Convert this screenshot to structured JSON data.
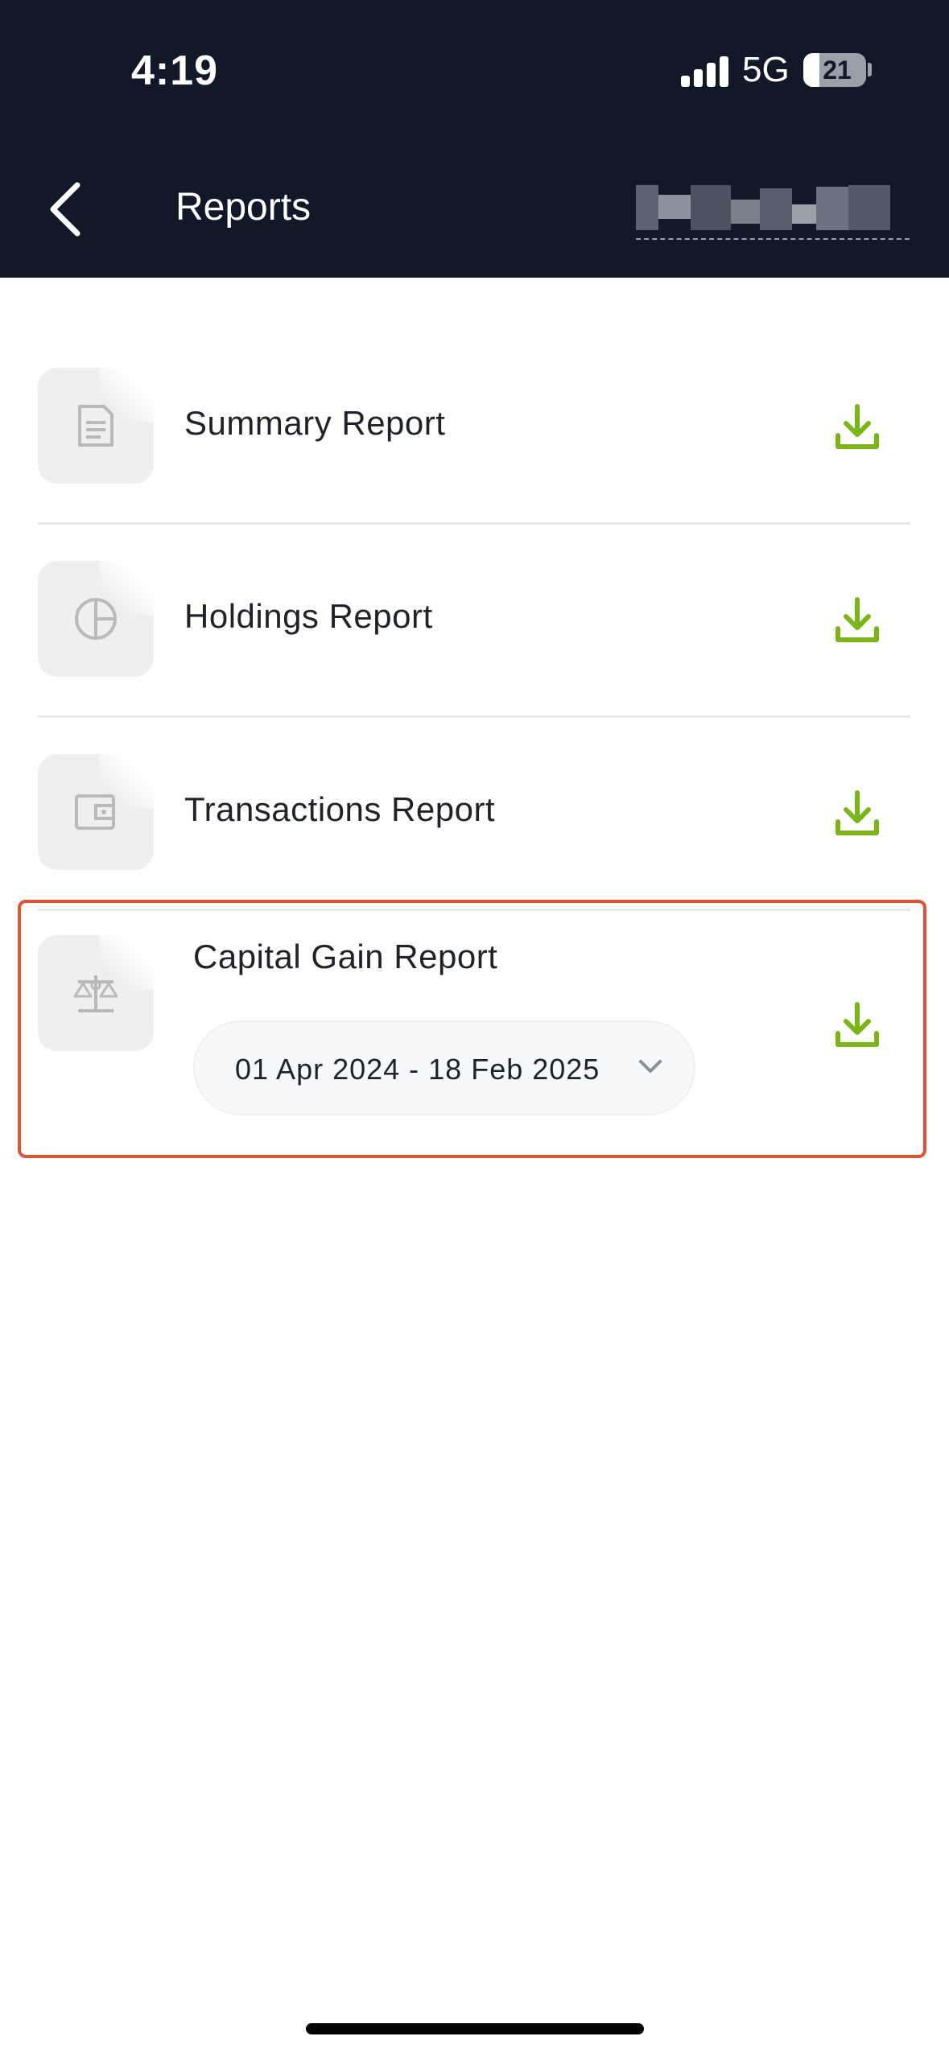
{
  "status_bar": {
    "time": "4:19",
    "network": "5G",
    "battery": "21"
  },
  "header": {
    "title": "Reports"
  },
  "reports": [
    {
      "label": "Summary Report",
      "icon": "document-icon"
    },
    {
      "label": "Holdings Report",
      "icon": "pie-chart-icon"
    },
    {
      "label": "Transactions Report",
      "icon": "wallet-icon"
    }
  ],
  "capital_gain": {
    "label": "Capital Gain Report",
    "icon": "scales-icon",
    "date_range": "01 Apr 2024 - 18 Feb 2025"
  },
  "colors": {
    "header_bg": "#111827",
    "download_green": "#7cb518",
    "highlight_border": "#e05433"
  }
}
